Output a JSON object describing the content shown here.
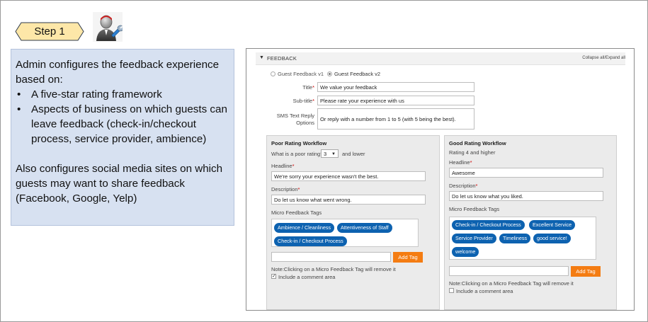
{
  "step": {
    "label": "Step 1"
  },
  "icons": {
    "admin": "admin-user-wrench-icon"
  },
  "description": {
    "intro": "Admin configures the feedback experience based on:",
    "bullets": [
      "A five-star rating framework",
      "Aspects of business on which guests can leave feedback (check-in/checkout process, service provider, ambience)"
    ],
    "social": "Also configures social media sites on which guests may want to share feedback (Facebook, Google, Yelp)"
  },
  "feedback": {
    "section_title": "FEEDBACK",
    "collapse_label": "Collapse all/Expand all",
    "versions": [
      {
        "label": "Guest Feedback v1",
        "selected": false
      },
      {
        "label": "Guest Feedback v2",
        "selected": true
      }
    ],
    "fields": {
      "title": {
        "label": "Title",
        "value": "We value your feedback"
      },
      "subtitle": {
        "label": "Sub-title",
        "value": "Please rate your experience with us"
      },
      "sms": {
        "label_line1": "SMS Text Reply",
        "label_line2": "Options",
        "value": "Or reply with a number from 1 to 5 (with 5 being the best)."
      }
    },
    "poor": {
      "title": "Poor Rating Workflow",
      "question": "What is a poor rating?",
      "rating_value": "3",
      "suffix": "and lower",
      "headline_label": "Headline",
      "headline_value": "We're sorry your experience wasn't the best.",
      "description_label": "Description",
      "description_value": "Do let us know what went wrong.",
      "tags_label": "Micro Feedback Tags",
      "tags": [
        "Ambience / Cleanliness",
        "Attentiveness of Staff",
        "Check-in / Checkout Process"
      ],
      "add_tag_label": "Add Tag",
      "note": "Note:Clicking on a Micro Feedback Tag will remove it",
      "comment_label": "Include a comment area",
      "comment_checked": true
    },
    "good": {
      "title": "Good Rating Workflow",
      "rating_text": "Rating 4 and higher",
      "headline_label": "Headline",
      "headline_value": "Awesome",
      "description_label": "Description",
      "description_value": "Do let us know what you liked.",
      "tags_label": "Micro Feedback Tags",
      "tags": [
        "Check-in / Checkout Process",
        "Excellent Service",
        "Service Provider",
        "Timeliness",
        "good service!",
        "welcome"
      ],
      "add_tag_label": "Add Tag",
      "note": "Note:Clicking on a Micro Feedback Tag will remove it",
      "comment_label": "Include a comment area",
      "comment_checked": false
    }
  }
}
